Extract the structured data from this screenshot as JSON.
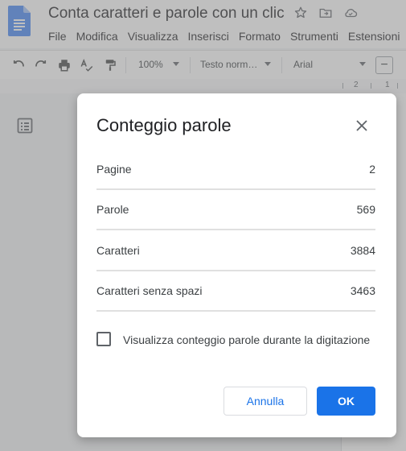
{
  "app": {
    "doc_title": "Conta caratteri e parole con un clic",
    "icons": [
      "docs-logo-icon",
      "star-icon",
      "move-folder-icon",
      "cloud-saved-icon"
    ]
  },
  "menu": {
    "items": [
      "File",
      "Modifica",
      "Visualizza",
      "Inserisci",
      "Formato",
      "Strumenti",
      "Estensioni"
    ]
  },
  "toolbar": {
    "zoom": "100%",
    "style": "Testo norm…",
    "font": "Arial",
    "zoom_out": "−",
    "icons": [
      "undo-icon",
      "redo-icon",
      "print-icon",
      "spellcheck-icon",
      "paint-format-icon"
    ]
  },
  "ruler": {
    "marks": [
      "2",
      "1"
    ]
  },
  "dialog": {
    "title": "Conteggio parole",
    "stats": [
      {
        "label": "Pagine",
        "value": "2"
      },
      {
        "label": "Parole",
        "value": "569"
      },
      {
        "label": "Caratteri",
        "value": "3884"
      },
      {
        "label": "Caratteri senza spazi",
        "value": "3463"
      }
    ],
    "checkbox_label": "Visualizza conteggio parole durante la digitazione",
    "checkbox_checked": false,
    "cancel_label": "Annulla",
    "ok_label": "OK"
  },
  "colors": {
    "accent": "#1a73e8",
    "docs_blue": "#4285f4",
    "text": "#202124",
    "divider": "#e0e0e0"
  }
}
